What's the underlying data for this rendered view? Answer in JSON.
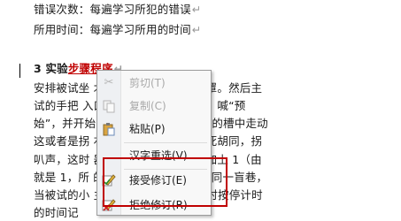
{
  "document": {
    "lines": [
      {
        "text": "错误次数：每遍学习所犯的错误",
        "mark": "↵"
      },
      {
        "text": "所用时间：每遍学习所用的时间",
        "mark": "↵"
      },
      {
        "prefix": "3 实验",
        "revised": "步骤程序",
        "mark": "↵"
      },
      {
        "text": "安排被试坐                                木棒的上端，戴上遮眼罩。然后主"
      },
      {
        "text": "试的手把                                  入口处。主试握好计时器，喊“预"
      },
      {
        "text": "始”，并开始                              拿着小棒垂直地在迷宫的槽中走动"
      },
      {
        "text": "这或者是拐                                右拐就通过了，或者是死胡同，拐"
      },
      {
        "text": "叭声，这时                                器也会自动在错误次数加上 1（由"
      },
      {
        "text": "就是 1，所                                的）。如果连续几次进入同一盲巷，"
      },
      {
        "text": "当被试的小                                主试立即说“到了”，同时按停计时"
      },
      {
        "text": "的时间记"
      }
    ]
  },
  "context_menu": {
    "items": [
      {
        "label": "剪切(T)",
        "icon": "scissors-icon",
        "disabled": true
      },
      {
        "label": "复制(C)",
        "icon": "copy-icon",
        "disabled": true
      },
      {
        "label": "粘贴(P)",
        "icon": "paste-icon",
        "disabled": false
      },
      {
        "label": "汉字重选(V)",
        "icon": "",
        "disabled": false
      },
      {
        "label": "接受修订(E)",
        "icon": "accept-revision-icon",
        "disabled": false
      },
      {
        "label": "拒绝修订(R)",
        "icon": "reject-revision-icon",
        "disabled": false
      }
    ]
  },
  "colors": {
    "highlight_box": "#c00000",
    "revision_text": "#c00000"
  }
}
